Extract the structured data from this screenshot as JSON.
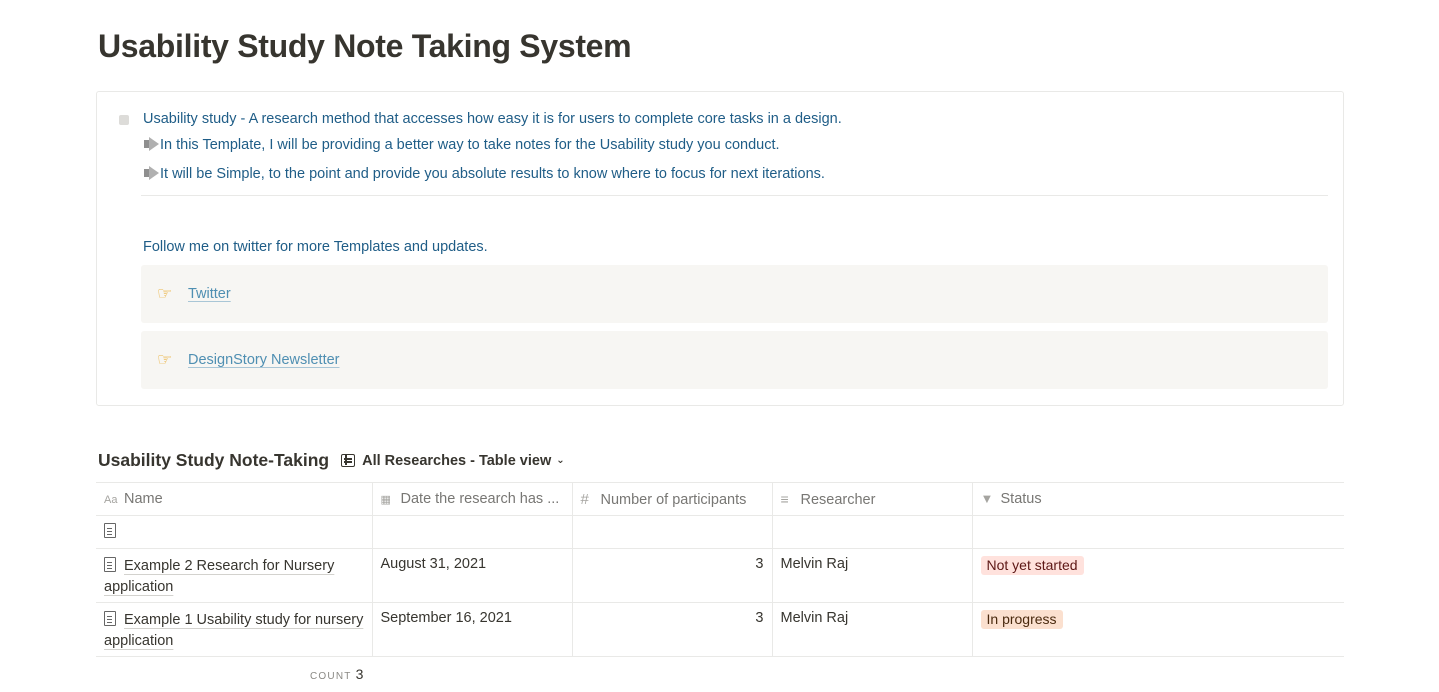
{
  "page": {
    "title": "Usability Study Note Taking System"
  },
  "callout": {
    "line1": "Usability study - A research method that accesses how easy it is for users to complete core tasks in a design.",
    "line2": "In this Template, I will be providing a better way to take notes for the Usability study you conduct.",
    "line3": "It will be Simple, to the point and provide you absolute results to know where to focus for next iterations.",
    "follow": "Follow me on twitter for more Templates and updates.",
    "links": [
      {
        "icon": "pointing-hand-icon",
        "label": "Twitter"
      },
      {
        "icon": "pointing-hand-icon",
        "label": "DesignStory Newsletter"
      }
    ]
  },
  "database": {
    "title": "Usability Study Note-Taking",
    "view": "All Researches - Table view",
    "columns": [
      {
        "label": "Name",
        "icon": "text-icon"
      },
      {
        "label": "Date the research has ...",
        "icon": "calendar-icon"
      },
      {
        "label": "Number of participants",
        "icon": "hash-icon"
      },
      {
        "label": "Researcher",
        "icon": "lines-icon"
      },
      {
        "label": "Status",
        "icon": "status-icon"
      }
    ],
    "rows": [
      {
        "name": "Example 2 Research for Nursery application",
        "date": "August 31, 2021",
        "participants": "3",
        "researcher": "Melvin Raj",
        "status": "Not yet started",
        "status_color": "#ffe2dd"
      },
      {
        "name": "Example 1 Usability study for nursery application",
        "date": "September 16, 2021",
        "participants": "3",
        "researcher": "Melvin Raj",
        "status": "In progress",
        "status_color": "#fbe0cf"
      }
    ],
    "count_label": "COUNT",
    "count_value": "3"
  }
}
